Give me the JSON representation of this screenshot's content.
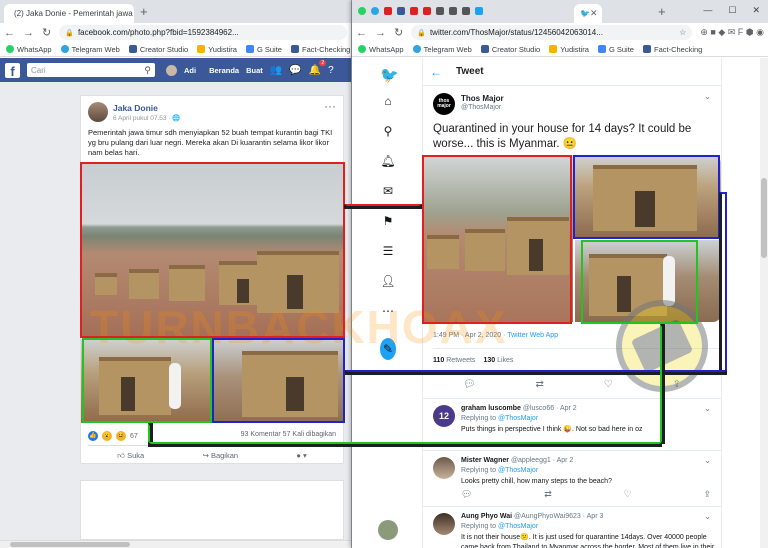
{
  "left_window": {
    "tabs": [
      {
        "title": "(2) Jaka Donie - Pemerintah jawa"
      }
    ],
    "url": "facebook.com/photo.php?fbid=1592384962...",
    "facebook": {
      "search_placeholder": "Cari",
      "user": "Adi",
      "nav": [
        "Beranda",
        "Buat"
      ],
      "notification_count": "2"
    },
    "post": {
      "author": "Jaka Donie",
      "date": "6 April pukul 07.53 · 🌐",
      "text": "Pemerintah jawa timur sdh menyiapkan 52 buah tempat kurantin bagi TKI yg bru pulang dari luar negri. Mereka akan Di kuarantin selama likor likor nam belas hari.",
      "reaction_count": "67",
      "comments_shares": "93 Komentar  57 Kali dibagikan",
      "actions": [
        "Suka",
        "Bagikan"
      ]
    }
  },
  "right_window": {
    "url": "twitter.com/ThosMajor/status/12456042063014...",
    "tweet_page_title": "Tweet",
    "tweet": {
      "author_name": "Thos Major",
      "author_handle": "@ThosMajor",
      "avatar_text": "thos major",
      "text": "Quarantined in your house for 14 days? It could be worse... this is Myanmar. 😐",
      "time": "1:49 PM · Apr 2, 2020 ·",
      "source": "Twitter Web App",
      "retweets": "110",
      "retweets_label": "Retweets",
      "likes": "130",
      "likes_label": "Likes"
    },
    "replies": [
      {
        "name": "graham luscombe",
        "handle": "@lusco66 · Apr 2",
        "to": "@ThosMajor",
        "text": "Puts things in perspective I think 😜. Not so bad here in oz",
        "avatar_text": "12"
      },
      {
        "name": "Mister Wagner",
        "handle": "@appleegg1 · Apr 2",
        "to": "@ThosMajor",
        "text": "Looks pretty chill, how many steps to the beach?"
      },
      {
        "name": "Aung Phyo Wai",
        "handle": "@AungPhyoWai9623 · Apr 3",
        "to": "@ThosMajor",
        "text": "It is not their house😕. It is just used for quarantine 14days. Over 40000 people came back from Thailand to Myanmar across the border. Most of them live in their"
      }
    ]
  },
  "bookmarks": [
    {
      "label": "WhatsApp",
      "color": "#25d366"
    },
    {
      "label": "Telegram Web",
      "color": "#2ca5e0"
    },
    {
      "label": "Creator Studio",
      "color": "#3b5998"
    },
    {
      "label": "Yudistira",
      "color": "#f4b400"
    },
    {
      "label": "G Suite",
      "color": "#4285f4"
    },
    {
      "label": "Fact-Checking",
      "color": "#3b5998"
    }
  ],
  "replying_to_label": "Replying to",
  "watermark": "TURNBACKHOAX",
  "colors": {
    "facebook_blue": "#3b5998",
    "twitter_blue": "#1da1f2",
    "red_outline": "#e02020",
    "green_outline": "#22c322",
    "blue_outline": "#2222cc"
  }
}
